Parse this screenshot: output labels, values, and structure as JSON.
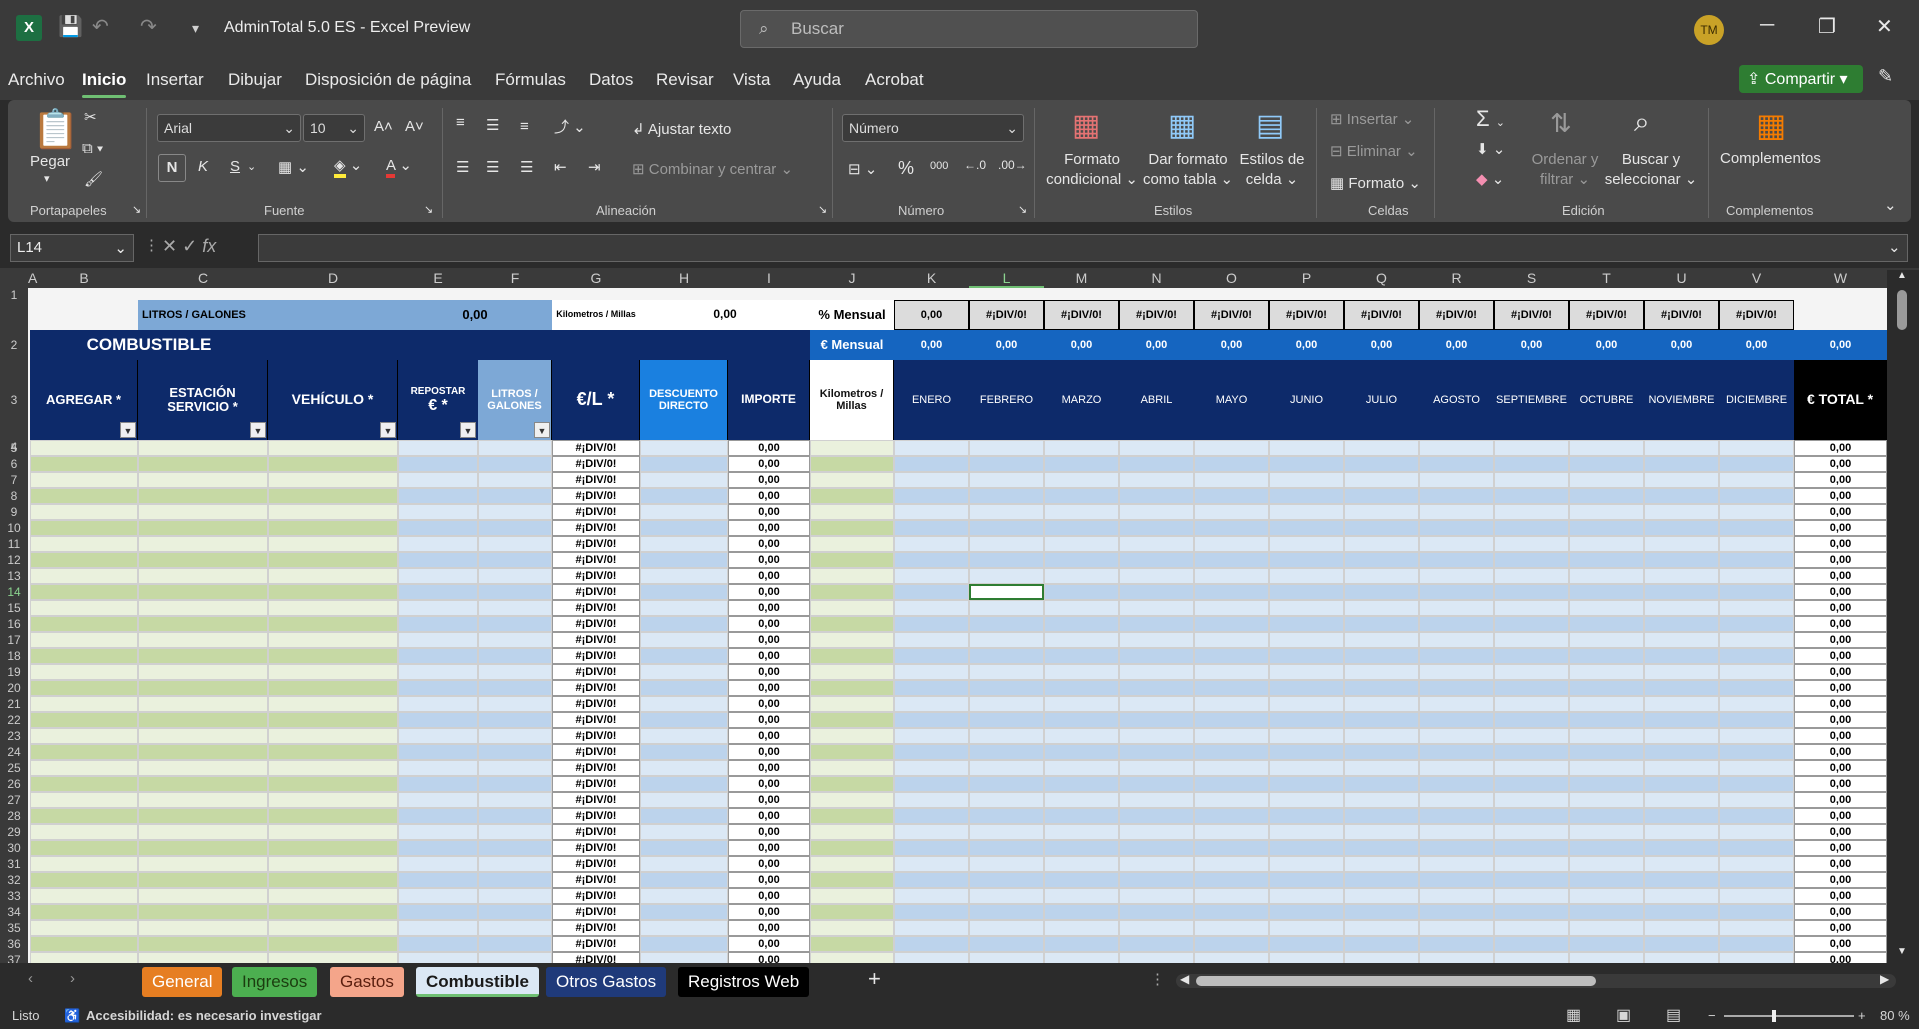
{
  "window": {
    "title": "AdminTotal 5.0 ES  -  Excel Preview",
    "app_icon": "X",
    "search_placeholder": "Buscar",
    "avatar": "TM"
  },
  "menu": [
    "Archivo",
    "Inicio",
    "Insertar",
    "Dibujar",
    "Disposición de página",
    "Fórmulas",
    "Datos",
    "Revisar",
    "Vista",
    "Ayuda",
    "Acrobat"
  ],
  "share_label": "Compartir",
  "ribbon": {
    "clipboard": {
      "paste": "Pegar",
      "label": "Portapapeles"
    },
    "font": {
      "name": "Arial",
      "size": "10",
      "bold": "N",
      "italic": "K",
      "underline": "S",
      "label": "Fuente"
    },
    "alignment": {
      "wrap": "Ajustar texto",
      "merge": "Combinar y centrar",
      "label": "Alineación"
    },
    "number": {
      "format": "Número",
      "label": "Número"
    },
    "styles": {
      "conditional": "Formato condicional",
      "table": "Dar formato como tabla",
      "cell": "Estilos de celda",
      "label": "Estilos"
    },
    "cells": {
      "insert": "Insertar",
      "delete": "Eliminar",
      "format": "Formato",
      "label": "Celdas"
    },
    "editing": {
      "sort": "Ordenar y filtrar",
      "find": "Buscar y seleccionar",
      "label": "Edición"
    },
    "addins": {
      "addins": "Complementos",
      "label": "Complementos"
    }
  },
  "name_box": "L14",
  "columns": [
    "A",
    "B",
    "C",
    "D",
    "E",
    "F",
    "G",
    "H",
    "I",
    "J",
    "K",
    "L",
    "M",
    "N",
    "O",
    "P",
    "Q",
    "R",
    "S",
    "T",
    "U",
    "V",
    "W"
  ],
  "sheet": {
    "litros_label": "LITROS / GALONES",
    "litros_value": "0,00",
    "km_label": "Kilometros / Millas",
    "km_value": "0,00",
    "pct_mensual": "% Mensual",
    "eur_mensual": "€ Mensual",
    "title": "COMBUSTIBLE",
    "pct_values": [
      "0,00",
      "#¡DIV/0!",
      "#¡DIV/0!",
      "#¡DIV/0!",
      "#¡DIV/0!",
      "#¡DIV/0!",
      "#¡DIV/0!",
      "#¡DIV/0!",
      "#¡DIV/0!",
      "#¡DIV/0!",
      "#¡DIV/0!",
      "#¡DIV/0!"
    ],
    "eur_values": [
      "0,00",
      "0,00",
      "0,00",
      "0,00",
      "0,00",
      "0,00",
      "0,00",
      "0,00",
      "0,00",
      "0,00",
      "0,00",
      "0,00"
    ],
    "eur_total": "0,00",
    "headers": {
      "agregar": "AGREGAR *",
      "estacion": "ESTACIÓN SERVICIO *",
      "vehiculo": "VEHÍCULO *",
      "repostar": "REPOSTAR",
      "euro_star": "€ *",
      "litros": "LITROS / GALONES",
      "el": "€/L *",
      "descuento": "DESCUENTO DIRECTO",
      "importe": "IMPORTE",
      "km": "Kilometros / Millas",
      "total": "€ TOTAL *"
    },
    "months": [
      "ENERO",
      "FEBRERO",
      "MARZO",
      "ABRIL",
      "MAYO",
      "JUNIO",
      "JULIO",
      "AGOSTO",
      "SEPTIEMBRE",
      "OCTUBRE",
      "NOVIEMBRE",
      "DICIEMBRE"
    ],
    "row_numbers": [
      "1",
      "2",
      "3",
      "4",
      "5",
      "6",
      "7",
      "8",
      "9",
      "10",
      "11",
      "12",
      "13",
      "14",
      "15",
      "16",
      "17",
      "18",
      "19",
      "20",
      "21",
      "22",
      "23",
      "24",
      "25",
      "26",
      "27",
      "28",
      "29",
      "30",
      "31",
      "32",
      "33",
      "34",
      "35",
      "36",
      "37"
    ],
    "data_el": "#¡DIV/0!",
    "data_zero": "0,00"
  },
  "tabs": [
    {
      "label": "General",
      "bg": "#e67e22",
      "fg": "#ffffff"
    },
    {
      "label": "Ingresos",
      "bg": "#4caf50",
      "fg": "#1b3d0f"
    },
    {
      "label": "Gastos",
      "bg": "#f4a58a",
      "fg": "#5a1e0e"
    },
    {
      "label": "Combustible",
      "bg": "#dbe8f5",
      "fg": "#1a1a1a"
    },
    {
      "label": "Otros Gastos",
      "bg": "#1f3a7a",
      "fg": "#ffffff"
    },
    {
      "label": "Registros Web",
      "bg": "#000000",
      "fg": "#ffffff"
    }
  ],
  "status": {
    "ready": "Listo",
    "accessibility": "Accesibilidad: es necesario investigar",
    "zoom": "80 %"
  },
  "colors": {
    "navy": "#0d2a6a",
    "blue": "#1565c0",
    "lightblue": "#dbe8f5",
    "green": "#c6d9a4",
    "accent": "#2e7d32"
  }
}
